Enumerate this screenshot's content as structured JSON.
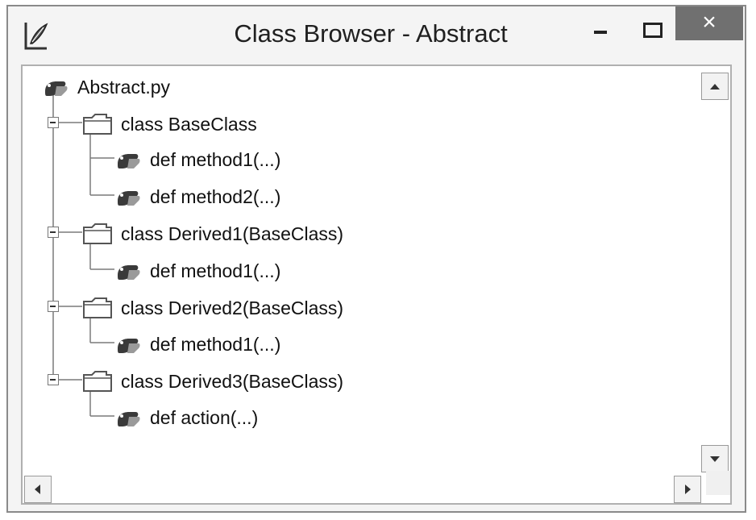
{
  "window": {
    "title": "Class Browser - Abstract",
    "close_symbol": "×",
    "icons": {
      "app": "idle-feather-icon",
      "minimize": "minimize-icon",
      "maximize": "maximize-icon",
      "close": "close-icon"
    }
  },
  "tree": {
    "root": {
      "label": "Abstract.py",
      "icon": "python-module-icon"
    },
    "classes": [
      {
        "label": "class BaseClass",
        "methods": [
          "def method1(...)",
          "def method2(...)"
        ]
      },
      {
        "label": "class Derived1(BaseClass)",
        "methods": [
          "def method1(...)"
        ]
      },
      {
        "label": "class Derived2(BaseClass)",
        "methods": [
          "def method1(...)"
        ]
      },
      {
        "label": "class Derived3(BaseClass)",
        "methods": [
          "def action(...)"
        ]
      }
    ]
  },
  "scrollbars": {
    "icons": [
      "scroll-up-arrow-icon",
      "scroll-down-arrow-icon",
      "scroll-left-arrow-icon",
      "scroll-right-arrow-icon"
    ]
  },
  "colors": {
    "close_button": "#707070",
    "tree_background": "#ffffff",
    "tree_lines": "#7a7a7a"
  }
}
